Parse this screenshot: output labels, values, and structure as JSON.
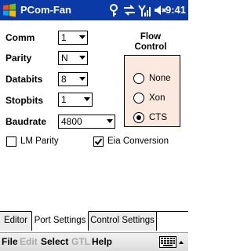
{
  "title_bar": {
    "app_title": "PCom-Fan",
    "time": "9:41",
    "icons": [
      "windows-start-icon",
      "bluetooth-icon",
      "connectivity-icon",
      "signal-icon",
      "volume-icon"
    ]
  },
  "form": {
    "comm": {
      "label": "Comm",
      "value": "1"
    },
    "parity": {
      "label": "Parity",
      "value": "N"
    },
    "databits": {
      "label": "Databits",
      "value": "8"
    },
    "stopbits": {
      "label": "Stopbits",
      "value": "1"
    },
    "baudrate": {
      "label": "Baudrate",
      "value": "4800"
    },
    "lm_parity": {
      "label": "LM Parity",
      "checked": false
    },
    "eia_conversion": {
      "label": "Eia Conversion",
      "checked": true
    }
  },
  "flow_control": {
    "title_line1": "Flow",
    "title_line2": "Control",
    "options": [
      {
        "label": "None",
        "selected": false
      },
      {
        "label": "Xon",
        "selected": false
      },
      {
        "label": "CTS",
        "selected": true
      }
    ]
  },
  "tabs": [
    {
      "label": "Editor",
      "active": false
    },
    {
      "label": "Port Settings",
      "active": true
    },
    {
      "label": "Control Settings",
      "active": false
    }
  ],
  "menu": {
    "file": "File",
    "edit": "Edit",
    "select": "Select",
    "gtl": "GTL",
    "help": "Help"
  },
  "colors": {
    "title_bar": "#0b3aa6",
    "flow_box": "#fbe8de"
  }
}
